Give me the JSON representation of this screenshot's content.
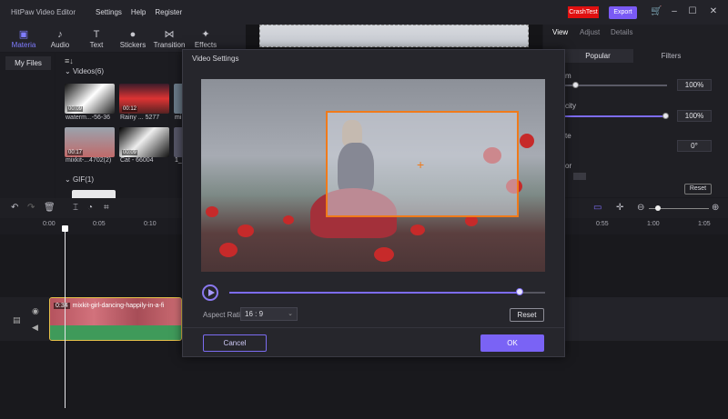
{
  "app": {
    "title": "HitPaw Video Editor"
  },
  "menu": [
    "Settings",
    "Help",
    "Register"
  ],
  "header": {
    "badge": "CrashTest",
    "export_label": "Export"
  },
  "toolbar": {
    "items": [
      {
        "label": "Materia",
        "icon": "materials-icon",
        "active": true
      },
      {
        "label": "Audio",
        "icon": "audio-icon"
      },
      {
        "label": "Text",
        "icon": "text-icon"
      },
      {
        "label": "Stickers",
        "icon": "stickers-icon"
      },
      {
        "label": "Transition",
        "icon": "transition-icon"
      },
      {
        "label": "Effects",
        "icon": "effects-icon"
      }
    ]
  },
  "sidebar": {
    "my_files": "My Files"
  },
  "media": {
    "videos_group": "Videos(6)",
    "gif_group": "GIF(1)",
    "clips": [
      {
        "duration": "00:09",
        "name": "waterm...-56-36"
      },
      {
        "duration": "00:12",
        "name": "Rainy ... 5277"
      },
      {
        "duration": "00:17",
        "name": "mixkit-...4702(2)"
      },
      {
        "duration": "00:09",
        "name": "Cat - 66004"
      }
    ],
    "partial_names": [
      "mi",
      "1_"
    ]
  },
  "right_panel": {
    "tabs": [
      "View",
      "Adjust",
      "Details"
    ],
    "subtabs": [
      "Popular",
      "Filters"
    ],
    "labels": [
      "m",
      "city",
      "te",
      "or"
    ],
    "values": [
      "100%",
      "100%",
      "0°"
    ],
    "reset_label": "Reset"
  },
  "timeline": {
    "ticks": [
      "0:00",
      "0:05",
      "0:10",
      "0:55",
      "1:00",
      "1:05"
    ],
    "clip": {
      "duration": "0:34",
      "name": "mixkit-girl-dancing-happily-in-a-fi"
    }
  },
  "modal": {
    "title": "Video Settings",
    "aspect_label": "Aspect Ratio",
    "aspect_value": "16 : 9",
    "reset_label": "Reset",
    "cancel_label": "Cancel",
    "ok_label": "OK",
    "progress": 0.92
  }
}
